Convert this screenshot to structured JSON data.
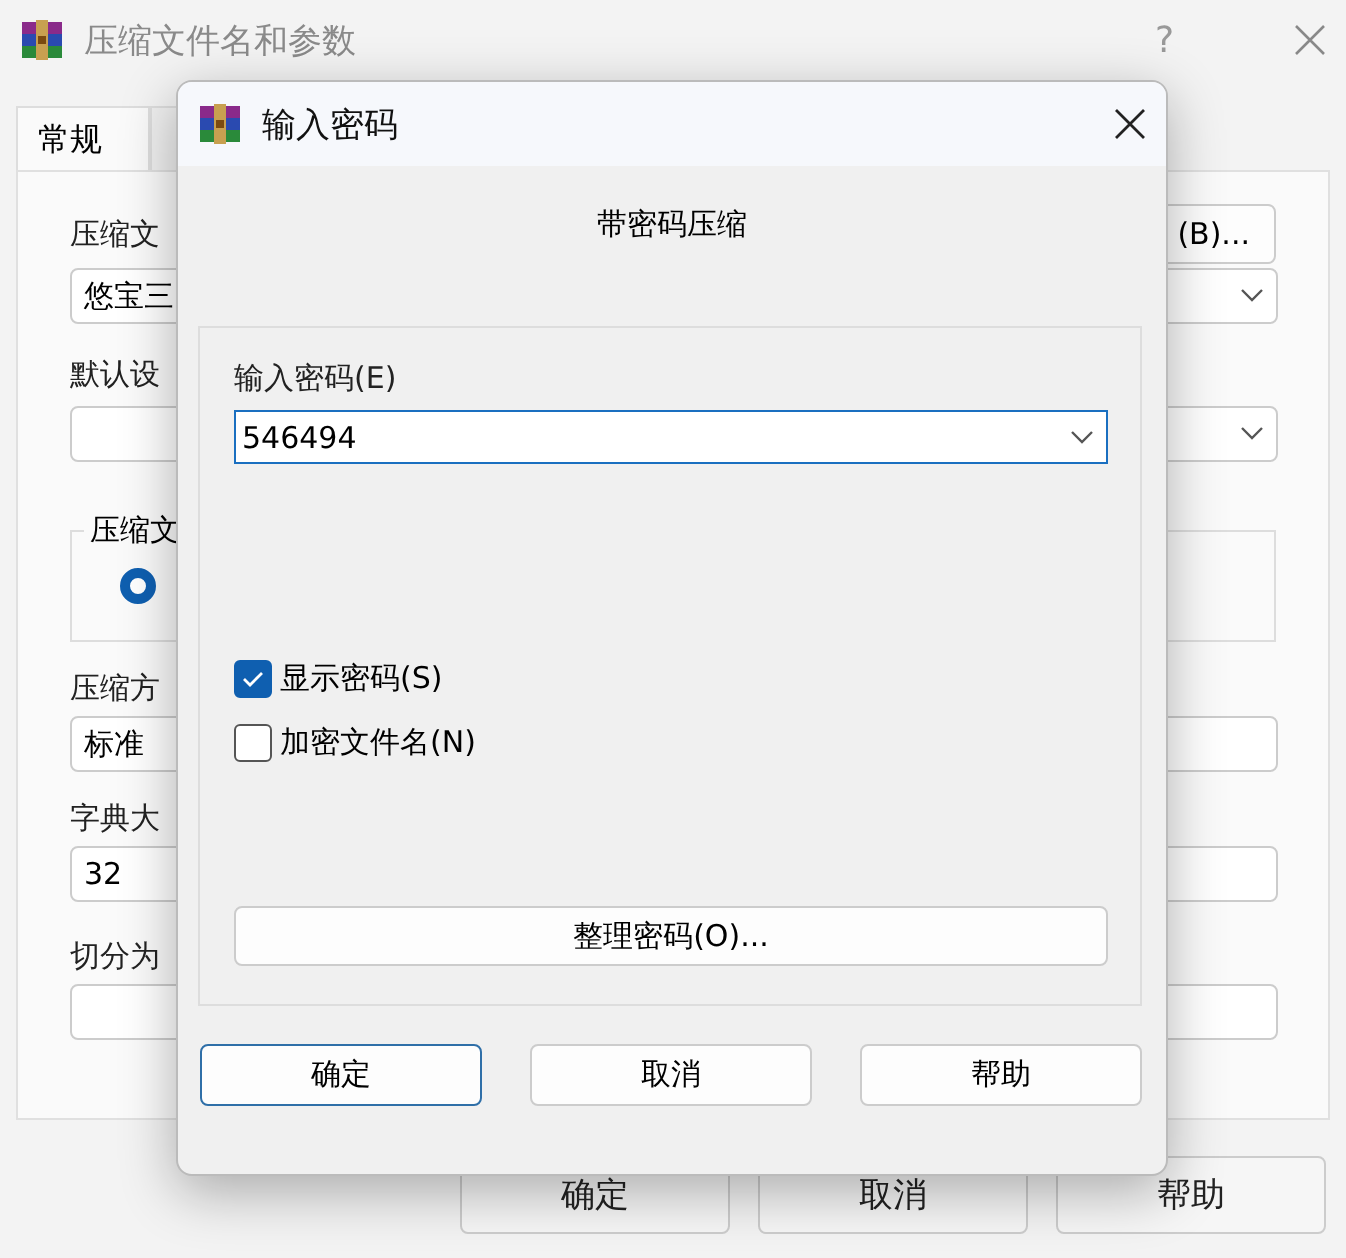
{
  "window": {
    "title": "压缩文件名和参数",
    "help_glyph": "?"
  },
  "tabs": [
    {
      "label": "常规",
      "selected": true
    }
  ],
  "general": {
    "archive_label": "压缩文",
    "browse_button": "(B)...",
    "archive_value": "悠宝三",
    "profile_label": "默认设",
    "format_group": "压缩文",
    "format_radio_selected": true,
    "method_label": "压缩方",
    "method_value": "标准",
    "dict_label": "字典大",
    "dict_value": "32",
    "split_label": "切分为"
  },
  "buttons": [
    "确定",
    "取消",
    "帮助"
  ],
  "dialog": {
    "title": "输入密码",
    "heading": "带密码压缩",
    "password_label": "输入密码(E)",
    "password_value": "546494",
    "options": [
      {
        "label": "显示密码(S)",
        "checked": true
      },
      {
        "label": "加密文件名(N)",
        "checked": false
      }
    ],
    "organize_button": "整理密码(O)...",
    "buttons": [
      {
        "label": "确定",
        "default": true
      },
      {
        "label": "取消",
        "default": false
      },
      {
        "label": "帮助",
        "default": false
      }
    ]
  }
}
